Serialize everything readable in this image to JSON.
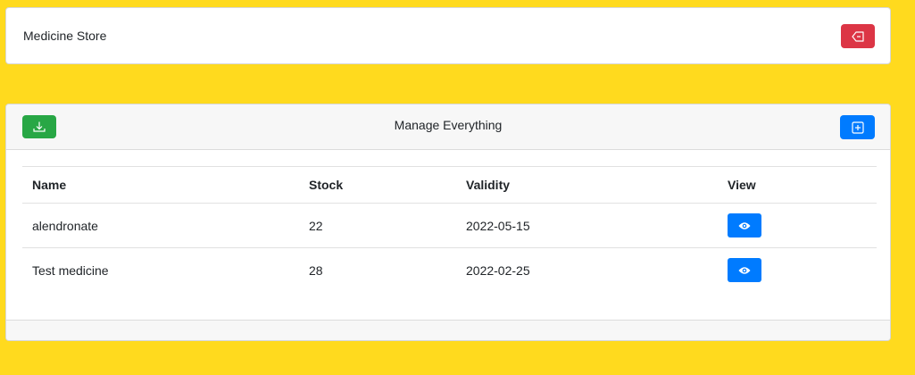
{
  "header": {
    "title": "Medicine Store",
    "logout_icon": "logout-icon",
    "logout_color": "#dc3545"
  },
  "panel": {
    "title": "Manage Everything",
    "download_icon": "download-icon",
    "download_color": "#28a745",
    "add_icon": "plus-square-icon",
    "add_color": "#007bff"
  },
  "table": {
    "columns": [
      "Name",
      "Stock",
      "Validity",
      "View"
    ],
    "rows": [
      {
        "name": "alendronate",
        "stock": "22",
        "validity": "2022-05-15",
        "view_icon": "eye-icon"
      },
      {
        "name": "Test medicine",
        "stock": "28",
        "validity": "2022-02-25",
        "view_icon": "eye-icon"
      }
    ]
  },
  "colors": {
    "background": "#ffda1e",
    "primary": "#007bff"
  }
}
